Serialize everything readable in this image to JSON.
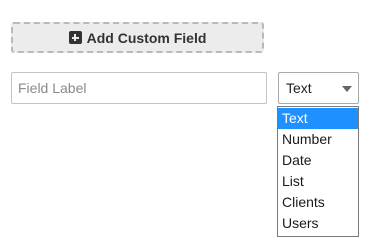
{
  "add_field_button": {
    "label": "Add Custom Field",
    "icon": "plus-square-icon"
  },
  "field_label_input": {
    "value": "",
    "placeholder": "Field Label"
  },
  "type_select": {
    "selected": "Text",
    "icon": "caret-down-icon",
    "options": [
      "Text",
      "Number",
      "Date",
      "List",
      "Clients",
      "Users"
    ],
    "highlighted_option": "Text"
  },
  "colors": {
    "highlight": "#1e90ff",
    "button_background": "#ececec",
    "button_border": "#b9b9b9"
  }
}
